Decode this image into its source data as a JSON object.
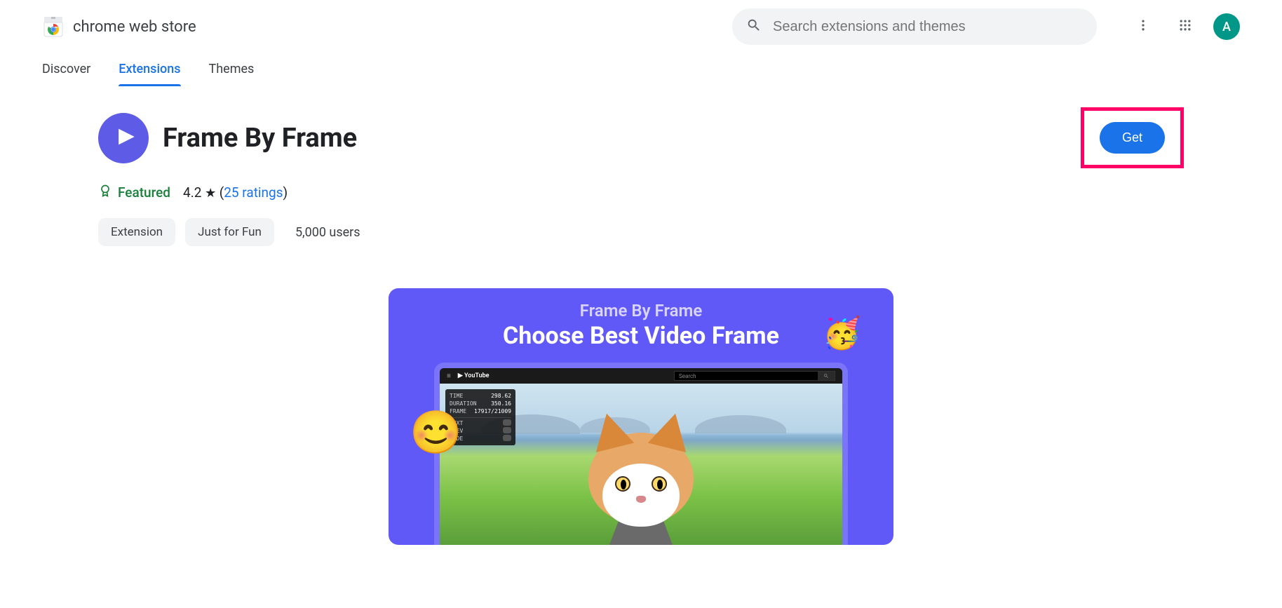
{
  "header": {
    "store_title": "chrome web store",
    "search_placeholder": "Search extensions and themes",
    "avatar_initial": "A"
  },
  "nav": {
    "tabs": [
      {
        "label": "Discover"
      },
      {
        "label": "Extensions"
      },
      {
        "label": "Themes"
      }
    ]
  },
  "ext": {
    "title": "Frame By Frame",
    "get_label": "Get",
    "featured_label": "Featured",
    "rating_value": "4.2",
    "ratings_count_label": "25 ratings",
    "chip_extension": "Extension",
    "chip_category": "Just for Fun",
    "users_text": "5,000 users"
  },
  "promo": {
    "subtitle": "Frame By Frame",
    "title": "Choose Best Video Frame",
    "yt_label": "YouTube",
    "yt_search": "Search",
    "overlay": {
      "time_k": "TIME",
      "time_v": "298.62",
      "dur_k": "DURATION",
      "dur_v": "350.16",
      "frame_k": "FRAME",
      "frame_v": "17917/21009",
      "next_k": "NEXT",
      "prev_k": "PREV",
      "hide_k": "HIDE"
    }
  }
}
